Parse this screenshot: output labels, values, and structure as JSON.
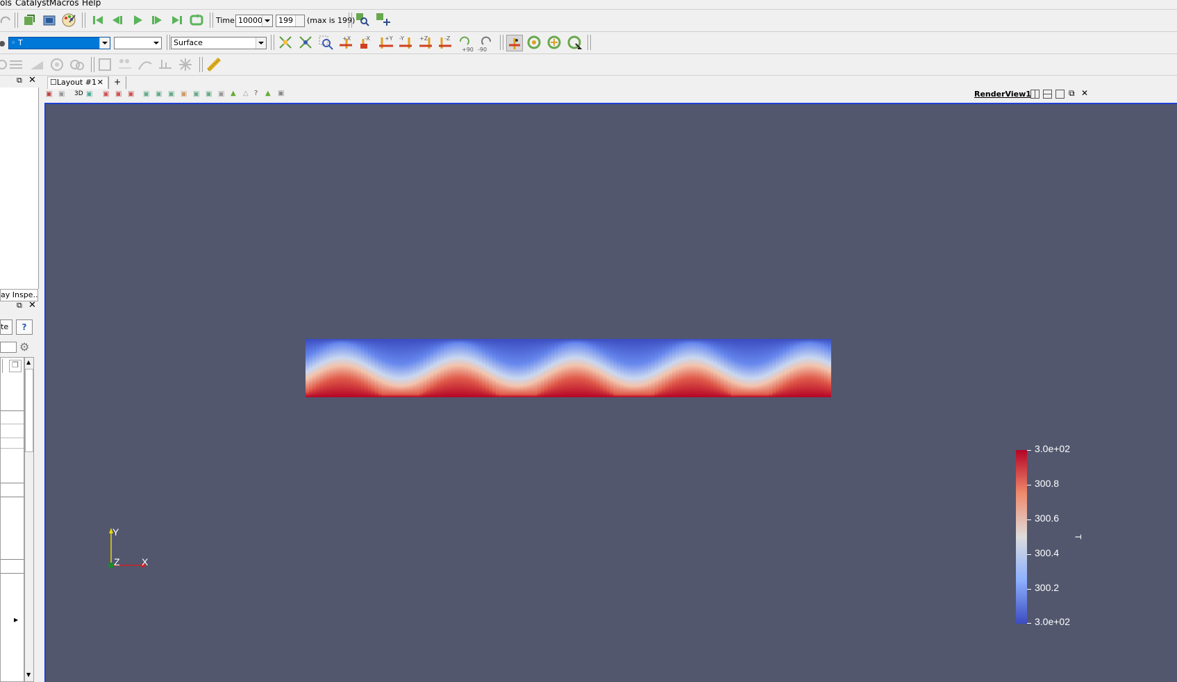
{
  "menu": {
    "items": [
      "ols",
      "Catalyst",
      "Macros",
      "Help"
    ]
  },
  "time_toolbar": {
    "time_label": "Time:",
    "time_value": "10000",
    "step_value": "199",
    "max_text": "(max is 199)"
  },
  "variable_toolbar": {
    "active_variable": "T",
    "component_value": "",
    "representation": "Surface"
  },
  "layout_tabs": {
    "tab_label": "Layout #1",
    "add_label": "+"
  },
  "view_toolbar": {
    "mode_3d": "3D",
    "view_name": "RenderView1"
  },
  "left_panel": {
    "display_inspector_tab": "ay Inspe...",
    "apply_button": "te",
    "help_button": "?"
  },
  "orientation_axes": {
    "y_label": "Y",
    "x_label": "X",
    "z_label": "Z"
  },
  "scalar_bar": {
    "title": "T",
    "labels": [
      "3.0e+02",
      "300.8",
      "300.6",
      "300.4",
      "300.2",
      "3.0e+02"
    ],
    "colors": [
      "#b40426",
      "#f7f7f7",
      "#3b4cc0"
    ]
  },
  "colors": {
    "background": "#52576e",
    "view_border": "#1f3fd4",
    "selection": "#0078d7"
  }
}
